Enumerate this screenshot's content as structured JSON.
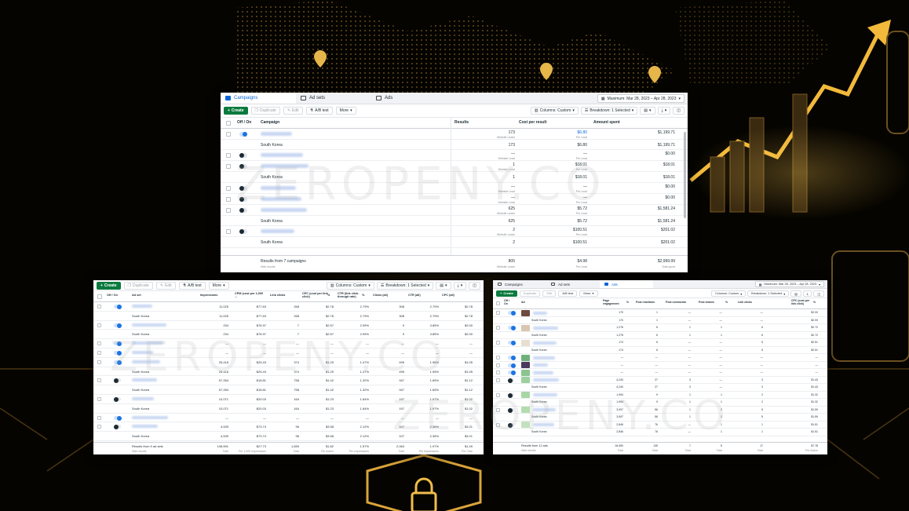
{
  "watermark": "ZEROPENY.CO",
  "campaigns_panel": {
    "tabs": [
      {
        "label": "Campaigns"
      },
      {
        "label": "Ad sets"
      },
      {
        "label": "Ads"
      }
    ],
    "date_range": "Maximum: Mar 28, 2023 – Apr 28, 2023",
    "toolbar": {
      "create": "Create",
      "duplicate": "Duplicate",
      "edit": "Edit",
      "ab_test": "A/B test",
      "more": "More",
      "columns": "Columns: Custom",
      "breakdown": "Breakdown: 1 Selected"
    },
    "columns": {
      "off_on": "Off / On",
      "name": "Campaign",
      "results": "Results",
      "cost": "Cost per result",
      "spent": "Amount spent"
    },
    "rows": [
      {
        "type": "main",
        "on": true,
        "results": "173",
        "results_sub": "Website Leads",
        "cost": "$6.80",
        "cost_sub": "Per Lead",
        "spent": "$1,199.71"
      },
      {
        "type": "bd",
        "name": "South Korea",
        "results": "173",
        "cost": "$6.80",
        "spent": "$1,199.71"
      },
      {
        "type": "main",
        "on": false,
        "results": "—",
        "results_sub": "Website Lead",
        "cost": "—",
        "cost_sub": "Per Lead",
        "spent": "$0.00"
      },
      {
        "type": "main",
        "on": false,
        "results": "1",
        "results_sub": "Website Lead",
        "cost": "$18.01",
        "cost_sub": "Per Lead",
        "spent": "$18.01"
      },
      {
        "type": "bd",
        "name": "South Korea",
        "results": "1",
        "cost": "$18.01",
        "spent": "$18.01"
      },
      {
        "type": "main",
        "on": false,
        "results": "—",
        "results_sub": "Website Lead",
        "cost": "—",
        "cost_sub": "Per Lead",
        "spent": "$0.00"
      },
      {
        "type": "main",
        "on": false,
        "results": "—",
        "results_sub": "Website Lead",
        "cost": "—",
        "cost_sub": "Per Lead",
        "spent": "$0.00"
      },
      {
        "type": "main",
        "on": false,
        "results": "625",
        "results_sub": "Website Leads",
        "cost": "$5.72",
        "cost_sub": "Per Lead",
        "spent": "$1,581.24"
      },
      {
        "type": "bd",
        "name": "South Korea",
        "results": "625",
        "cost": "$5.72",
        "spent": "$1,581.24"
      },
      {
        "type": "main",
        "on": false,
        "results": "2",
        "results_sub": "Website Leads",
        "cost": "$100.51",
        "cost_sub": "Per Lead",
        "spent": "$201.02"
      },
      {
        "type": "bd",
        "name": "South Korea",
        "results": "2",
        "cost": "$100.51",
        "spent": "$201.02"
      }
    ],
    "footer": {
      "label": "Results from 7 campaigns",
      "sub": "Hide results",
      "results": "805",
      "results_sub": "Website Leads",
      "cost": "$4.98",
      "cost_sub": "Per Lead",
      "spent": "$2,999.99",
      "spent_sub": "Total spent"
    }
  },
  "adsets_panel": {
    "toolbar": {
      "create": "Create",
      "duplicate": "Duplicate",
      "edit": "Edit",
      "ab_test": "A/B test",
      "more": "More",
      "columns": "Columns: Custom",
      "breakdown": "Breakdown: 1 Selected"
    },
    "columns": {
      "off_on": "Off / On",
      "name": "Ad set",
      "impressions": "Impressions",
      "cpm": "CPM (cost per 1,000 ...",
      "link_clicks": "Link clicks",
      "cpc_link": "CPC (cost per link click)",
      "pct": "%",
      "ctr_link": "CTR (link click-through rate)",
      "pct2": "%",
      "clicks_all": "Clicks (all)",
      "ctr_all": "CTR (all)",
      "cpc_all": "CPC (all)"
    },
    "rows": [
      {
        "type": "main",
        "on": true,
        "impressions": "11,025",
        "cpm": "$77.63",
        "link_clicks": "268",
        "cpc_link": "$2.78",
        "pct": "",
        "ctr_link": "2.79%",
        "pct2": "",
        "clicks_all": "308",
        "ctr_all": "2.79%",
        "cpc_all": "$2.78"
      },
      {
        "type": "bd",
        "name": "South Korea",
        "impressions": "11,025",
        "cpm": "$77.63",
        "link_clicks": "268",
        "cpc_link": "$2.78",
        "pct": "",
        "ctr_link": "2.79%",
        "pct2": "",
        "clicks_all": "308",
        "ctr_all": "2.79%",
        "cpc_all": "$2.78"
      },
      {
        "type": "main",
        "on": true,
        "impressions": "234",
        "cpm": "$76.97",
        "link_clicks": "7",
        "cpc_link": "$2.57",
        "pct": "",
        "ctr_link": "2.99%",
        "pct2": "",
        "clicks_all": "9",
        "ctr_all": "3.85%",
        "cpc_all": "$2.00"
      },
      {
        "type": "bd",
        "name": "South Korea",
        "impressions": "234",
        "cpm": "$76.97",
        "link_clicks": "7",
        "cpc_link": "$2.57",
        "pct": "",
        "ctr_link": "2.99%",
        "pct2": "",
        "clicks_all": "9",
        "ctr_all": "3.85%",
        "cpc_all": "$2.00"
      },
      {
        "type": "main",
        "on": true,
        "impressions": "—",
        "cpm": "—",
        "link_clicks": "—",
        "cpc_link": "—",
        "pct": "",
        "ctr_link": "—",
        "pct2": "",
        "clicks_all": "—",
        "ctr_all": "—",
        "cpc_all": "—"
      },
      {
        "type": "main",
        "on": true,
        "impressions": "—",
        "cpm": "—",
        "link_clicks": "—",
        "cpc_link": "—",
        "pct": "",
        "ctr_link": "—",
        "pct2": "",
        "clicks_all": "—",
        "ctr_all": "—",
        "cpc_all": "—"
      },
      {
        "type": "main",
        "on": true,
        "impressions": "25,418",
        "cpm": "$25.43",
        "link_clicks": "374",
        "cpc_link": "$1.29",
        "pct": "",
        "ctr_link": "1.47%",
        "pct2": "",
        "clicks_all": "495",
        "ctr_all": "1.95%",
        "cpc_all": "$1.05"
      },
      {
        "type": "bd",
        "name": "South Korea",
        "impressions": "25,418",
        "cpm": "$25.43",
        "link_clicks": "374",
        "cpc_link": "$1.29",
        "pct": "",
        "ctr_link": "1.47%",
        "pct2": "",
        "clicks_all": "495",
        "ctr_all": "1.95%",
        "cpc_all": "$1.05"
      },
      {
        "type": "main",
        "on": false,
        "impressions": "57,284",
        "cpm": "$18.81",
        "link_clicks": "758",
        "cpc_link": "$1.42",
        "pct": "",
        "ctr_link": "1.32%",
        "pct2": "",
        "clicks_all": "947",
        "ctr_all": "1.65%",
        "cpc_all": "$1.12"
      },
      {
        "type": "bd",
        "name": "South Korea",
        "impressions": "57,284",
        "cpm": "$18.81",
        "link_clicks": "758",
        "cpc_link": "$1.42",
        "pct": "",
        "ctr_link": "1.32%",
        "pct2": "",
        "clicks_all": "947",
        "ctr_all": "1.65%",
        "cpc_all": "$1.12"
      },
      {
        "type": "main",
        "on": false,
        "impressions": "10,071",
        "cpm": "$20.03",
        "link_clicks": "164",
        "cpc_link": "$1.23",
        "pct": "",
        "ctr_link": "1.64%",
        "pct2": "",
        "clicks_all": "197",
        "ctr_all": "1.97%",
        "cpc_all": "$1.02"
      },
      {
        "type": "bd",
        "name": "South Korea",
        "impressions": "10,071",
        "cpm": "$20.03",
        "link_clicks": "164",
        "cpc_link": "$1.23",
        "pct": "",
        "ctr_link": "1.64%",
        "pct2": "",
        "clicks_all": "197",
        "ctr_all": "1.97%",
        "cpc_all": "$1.02"
      },
      {
        "type": "main",
        "on": true,
        "impressions": "—",
        "cpm": "—",
        "link_clicks": "—",
        "cpc_link": "—",
        "pct": "",
        "ctr_link": "—",
        "pct2": "",
        "clicks_all": "—",
        "ctr_all": "—",
        "cpc_all": "—"
      },
      {
        "type": "main",
        "on": false,
        "impressions": "4,539",
        "cpm": "$73.74",
        "link_clicks": "96",
        "cpc_link": "$3.58",
        "pct": "",
        "ctr_link": "2.12%",
        "pct2": "",
        "clicks_all": "107",
        "ctr_all": "2.36%",
        "cpc_all": "$3.21"
      },
      {
        "type": "bd",
        "name": "South Korea",
        "impressions": "4,539",
        "cpm": "$73.74",
        "link_clicks": "96",
        "cpc_link": "$3.58",
        "pct": "",
        "ctr_link": "2.12%",
        "pct2": "",
        "clicks_all": "107",
        "ctr_all": "2.36%",
        "cpc_all": "$3.21"
      }
    ],
    "footer": {
      "label": "Results from 9 ad sets",
      "sub": "Hide results",
      "impressions": "108,591",
      "impressions_sub": "Total",
      "cpm": "$27.73",
      "cpm_sub": "Per 1,000 Impressions",
      "link_clicks": "1,659",
      "link_clicks_sub": "Total",
      "cpc_link": "$1.82",
      "cpc_link_sub": "Per Action",
      "pct": "",
      "ctr_link": "1.57%",
      "ctr_link_sub": "Per Impressions",
      "pct2": "",
      "clicks_all": "2,063",
      "clicks_all_sub": "Total",
      "ctr_all": "1.97%",
      "ctr_all_sub": "Per Impressions",
      "cpc_all": "$1.49",
      "cpc_all_sub": "Per Click"
    }
  },
  "ads_panel": {
    "tabs": [
      {
        "label": "Campaigns"
      },
      {
        "label": "Ad sets"
      },
      {
        "label": "Ads"
      }
    ],
    "date_range": "Maximum: Mar 28, 2023 – Apr 28, 2023",
    "toolbar": {
      "create": "Create",
      "duplicate": "Duplicate",
      "edit": "Edit",
      "ab_test": "A/B test",
      "more": "More",
      "columns": "Columns: Custom",
      "breakdown": "Breakdown: 1 Selected"
    },
    "columns": {
      "off_on": "Off / On",
      "name": "Ad",
      "page_eng": "Page engagement",
      "pct": "%",
      "reactions": "Post reactions",
      "comments": "Post comments",
      "shares": "Post shares",
      "pct2": "%",
      "link_clicks": "Link clicks",
      "cpc": "CPC (cost per link click)",
      "pct3": "%"
    },
    "rows": [
      {
        "type": "main",
        "on": true,
        "thumb": "#6f4a3e",
        "page_eng": "170",
        "reactions": "1",
        "comments": "—",
        "shares": "—",
        "link_clicks": "—",
        "cpc": "$2.00"
      },
      {
        "type": "bd",
        "name": "South Korea",
        "page_eng": "170",
        "reactions": "1",
        "comments": "—",
        "shares": "—",
        "link_clicks": "—",
        "cpc": "$2.00"
      },
      {
        "type": "main",
        "on": true,
        "thumb": "#d9c5b0",
        "page_eng": "1,276",
        "reactions": "6",
        "comments": "1",
        "shares": "1",
        "link_clicks": "6",
        "cpc": "$2.72"
      },
      {
        "type": "bd",
        "name": "South Korea",
        "page_eng": "1,276",
        "reactions": "6",
        "comments": "1",
        "shares": "1",
        "link_clicks": "6",
        "cpc": "$2.72"
      },
      {
        "type": "main",
        "on": true,
        "thumb": "#e7dfcf",
        "page_eng": "174",
        "reactions": "6",
        "comments": "—",
        "shares": "—",
        "link_clicks": "5",
        "cpc": "$2.51"
      },
      {
        "type": "bd",
        "name": "South Korea",
        "page_eng": "174",
        "reactions": "6",
        "comments": "—",
        "shares": "—",
        "link_clicks": "5",
        "cpc": "$2.51"
      },
      {
        "type": "main",
        "on": true,
        "thumb": "#6fb07a",
        "page_eng": "—",
        "reactions": "—",
        "comments": "—",
        "shares": "—",
        "link_clicks": "—",
        "cpc": "—"
      },
      {
        "type": "main",
        "on": true,
        "thumb": "#4a3a5c",
        "page_eng": "—",
        "reactions": "—",
        "comments": "—",
        "shares": "—",
        "link_clicks": "—",
        "cpc": "—"
      },
      {
        "type": "main",
        "on": true,
        "thumb": "#8cc48f",
        "page_eng": "—",
        "reactions": "—",
        "comments": "—",
        "shares": "—",
        "link_clicks": "—",
        "cpc": "—"
      },
      {
        "type": "main",
        "on": false,
        "thumb": "#9cd19f",
        "page_eng": "4,240",
        "reactions": "27",
        "comments": "3",
        "shares": "—",
        "link_clicks": "3",
        "cpc": "$1.43"
      },
      {
        "type": "bd",
        "name": "South Korea",
        "page_eng": "4,240",
        "reactions": "27",
        "comments": "3",
        "shares": "—",
        "link_clicks": "3",
        "cpc": "$1.43"
      },
      {
        "type": "main",
        "on": false,
        "thumb": "#a8d7a6",
        "page_eng": "1,994",
        "reactions": "9",
        "comments": "1",
        "shares": "1",
        "link_clicks": "2",
        "cpc": "$1.32"
      },
      {
        "type": "bd",
        "name": "South Korea",
        "page_eng": "1,994",
        "reactions": "9",
        "comments": "1",
        "shares": "1",
        "link_clicks": "2",
        "cpc": "$1.32"
      },
      {
        "type": "main",
        "on": false,
        "thumb": "#b3dcae",
        "page_eng": "3,997",
        "reactions": "56",
        "comments": "1",
        "shares": "2",
        "link_clicks": "5",
        "cpc": "$1.59"
      },
      {
        "type": "bd",
        "name": "South Korea",
        "page_eng": "3,997",
        "reactions": "56",
        "comments": "1",
        "shares": "2",
        "link_clicks": "5",
        "cpc": "$1.59"
      },
      {
        "type": "main",
        "on": false,
        "thumb": "#c2e2bd",
        "page_eng": "2,846",
        "reactions": "76",
        "comments": "—",
        "shares": "1",
        "link_clicks": "1",
        "cpc": "$1.51"
      },
      {
        "type": "bd",
        "name": "South Korea",
        "page_eng": "2,846",
        "reactions": "76",
        "comments": "—",
        "shares": "1",
        "link_clicks": "1",
        "cpc": "$1.51"
      }
    ],
    "footer": {
      "label": "Results from 12 ads",
      "sub": "Hide results",
      "page_eng": "16,950",
      "page_eng_sub": "Total",
      "reactions": "135",
      "reactions_sub": "Total",
      "comments": "7",
      "comments_sub": "Total",
      "shares": "5",
      "shares_sub": "Total",
      "link_clicks": "17",
      "link_clicks_sub": "Total",
      "cpc": "$7.78",
      "cpc_sub": "Per Action"
    }
  }
}
